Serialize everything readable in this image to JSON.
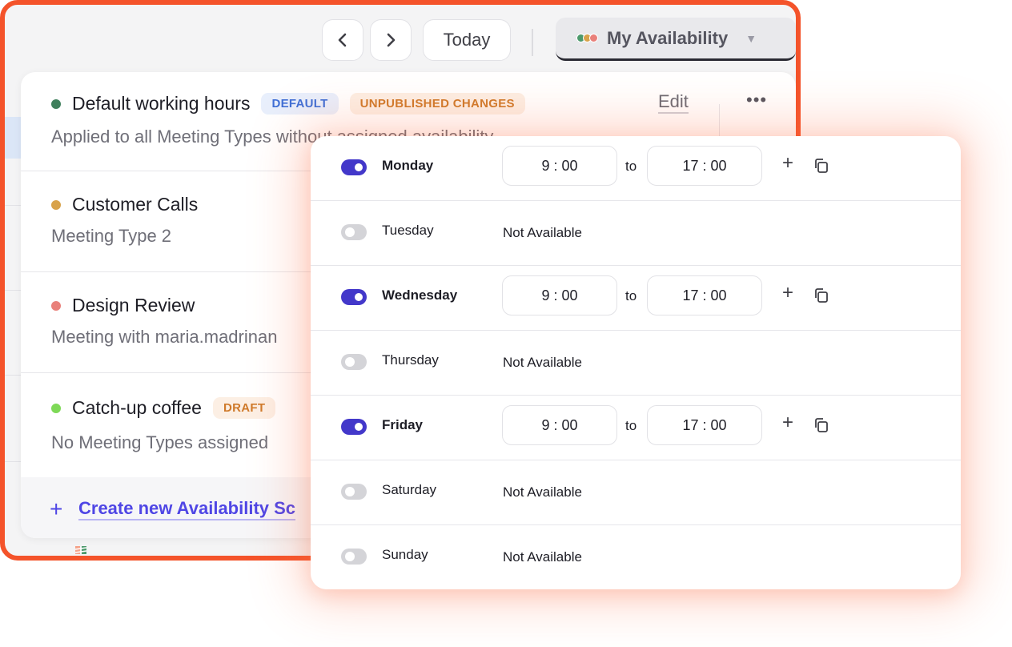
{
  "toolbar": {
    "prev_icon": "chevron-left-icon",
    "next_icon": "chevron-right-icon",
    "today_label": "Today",
    "availability_label": "My Availability",
    "availability_dot_colors": [
      "#4d9a6c",
      "#d8a24a",
      "#e9807a"
    ]
  },
  "list": {
    "items": [
      {
        "title": "Default working hours",
        "dot_color": "#3f7f5c",
        "badges": [
          "DEFAULT",
          "UNPUBLISHED CHANGES"
        ],
        "subtitle": "Applied to all Meeting Types without assigned availability",
        "edit_label": "Edit"
      },
      {
        "title": "Customer Calls",
        "dot_color": "#d8a24a",
        "subtitle": "Meeting Type 2"
      },
      {
        "title": "Design Review",
        "dot_color": "#e9807a",
        "subtitle": "Meeting with maria.madrinan"
      },
      {
        "title": "Catch-up coffee",
        "dot_color": "#7ed957",
        "badges": [
          "DRAFT"
        ],
        "subtitle": "No Meeting Types assigned"
      }
    ],
    "create_label": "Create new Availability Sc"
  },
  "schedule": {
    "days": [
      {
        "name": "Monday",
        "enabled": true,
        "start": "9 : 00",
        "to": "to",
        "end": "17 : 00"
      },
      {
        "name": "Tuesday",
        "enabled": false,
        "status": "Not Available"
      },
      {
        "name": "Wednesday",
        "enabled": true,
        "start": "9 : 00",
        "to": "to",
        "end": "17 : 00"
      },
      {
        "name": "Thursday",
        "enabled": false,
        "status": "Not Available"
      },
      {
        "name": "Friday",
        "enabled": true,
        "start": "9 : 00",
        "to": "to",
        "end": "17 : 00"
      },
      {
        "name": "Saturday",
        "enabled": false,
        "status": "Not Available"
      },
      {
        "name": "Sunday",
        "enabled": false,
        "status": "Not Available"
      }
    ]
  },
  "colors": {
    "frame": "#f4532a",
    "accent": "#4338ca",
    "toggle_off": "#d4d4d8"
  }
}
